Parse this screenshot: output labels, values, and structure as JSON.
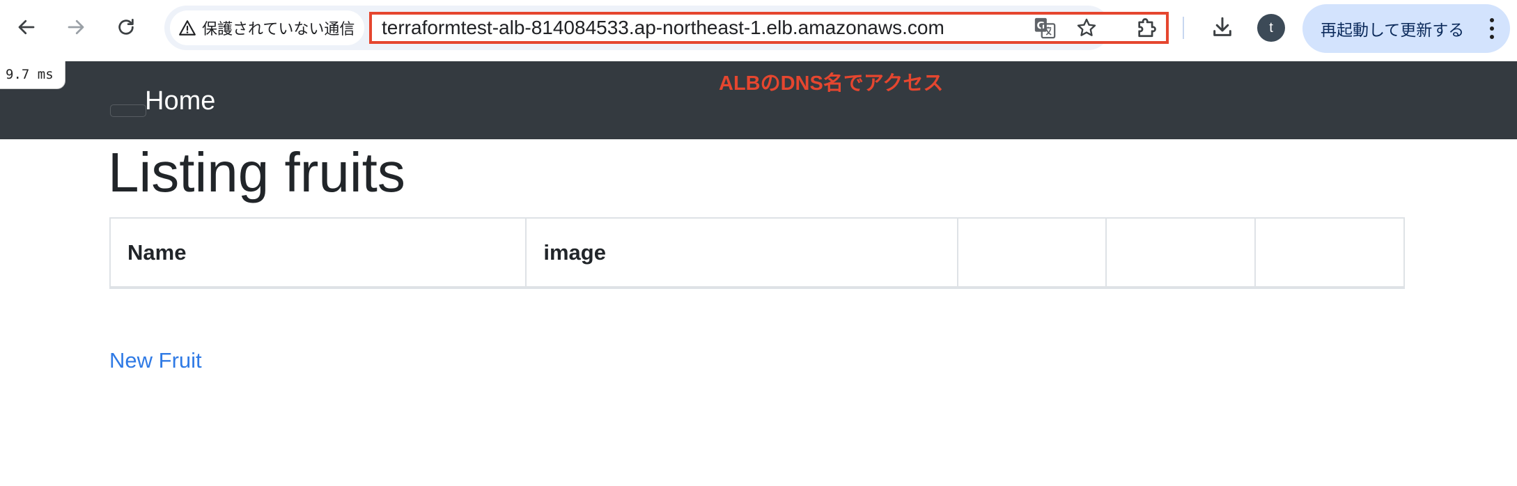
{
  "browser": {
    "security_label": "保護されていない通信",
    "url": "terraformtest-alb-814084533.ap-northeast-1.elb.amazonaws.com",
    "profile_initial": "t",
    "update_button_label": "再起動して更新する",
    "icons": {
      "back": "arrow-left-icon",
      "forward": "arrow-right-icon",
      "reload": "reload-icon",
      "warning": "warning-triangle-icon",
      "translate": "translate-icon",
      "bookmark": "star-icon",
      "extensions": "puzzle-icon",
      "downloads": "download-icon",
      "menu": "kebab-menu-icon"
    }
  },
  "page": {
    "navbar": {
      "brand": "Home"
    },
    "annotation": "ALBのDNS名でアクセス",
    "timing_badge": "9.7 ms",
    "title": "Listing fruits",
    "table": {
      "headers": [
        "Name",
        "image",
        "",
        "",
        ""
      ]
    },
    "new_link": "New Fruit"
  },
  "colors": {
    "navbar_bg": "#343a40",
    "annotation_red": "#e5462f",
    "link_blue": "#2f7ae5",
    "update_button_bg": "#d3e3fd"
  }
}
